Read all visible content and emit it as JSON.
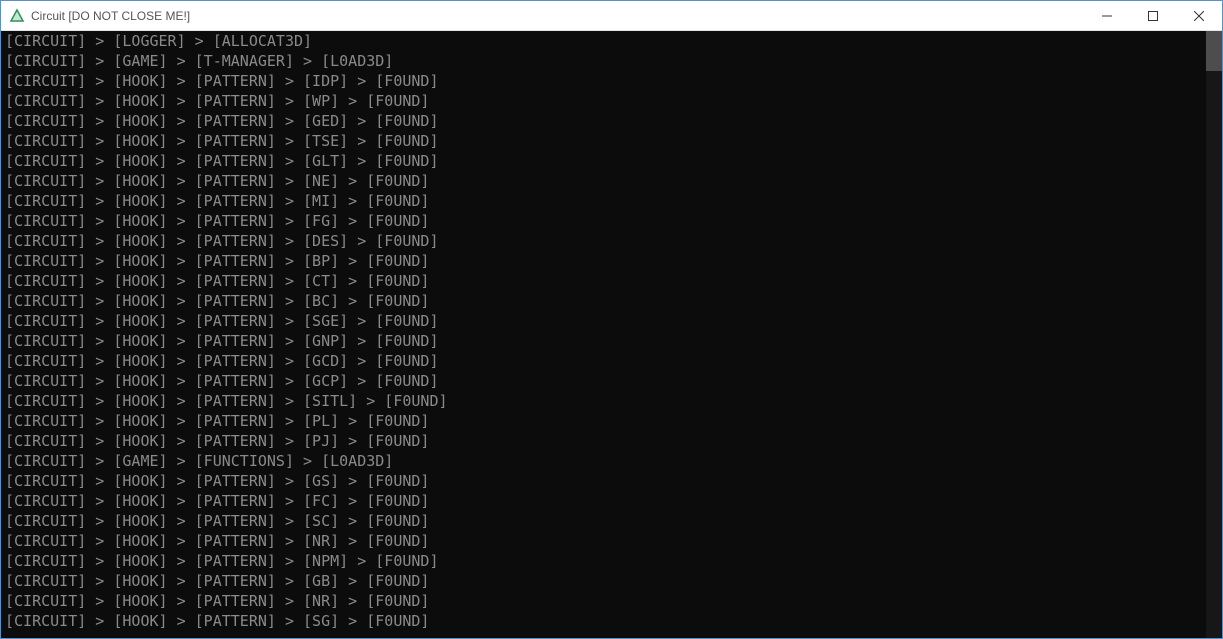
{
  "window": {
    "title": "Circuit [DO NOT CLOSE ME!]"
  },
  "log_lines": [
    [
      [
        "CIRCUIT"
      ],
      [
        "LOGGER"
      ],
      [
        "ALLOCAT3D"
      ]
    ],
    [
      [
        "CIRCUIT"
      ],
      [
        "GAME"
      ],
      [
        "T-MANAGER"
      ],
      [
        "L0AD3D"
      ]
    ],
    [
      [
        "CIRCUIT"
      ],
      [
        "HOOK"
      ],
      [
        "PATTERN"
      ],
      [
        "IDP"
      ],
      [
        "F0UND"
      ]
    ],
    [
      [
        "CIRCUIT"
      ],
      [
        "HOOK"
      ],
      [
        "PATTERN"
      ],
      [
        "WP"
      ],
      [
        "F0UND"
      ]
    ],
    [
      [
        "CIRCUIT"
      ],
      [
        "HOOK"
      ],
      [
        "PATTERN"
      ],
      [
        "GED"
      ],
      [
        "F0UND"
      ]
    ],
    [
      [
        "CIRCUIT"
      ],
      [
        "HOOK"
      ],
      [
        "PATTERN"
      ],
      [
        "TSE"
      ],
      [
        "F0UND"
      ]
    ],
    [
      [
        "CIRCUIT"
      ],
      [
        "HOOK"
      ],
      [
        "PATTERN"
      ],
      [
        "GLT"
      ],
      [
        "F0UND"
      ]
    ],
    [
      [
        "CIRCUIT"
      ],
      [
        "HOOK"
      ],
      [
        "PATTERN"
      ],
      [
        "NE"
      ],
      [
        "F0UND"
      ]
    ],
    [
      [
        "CIRCUIT"
      ],
      [
        "HOOK"
      ],
      [
        "PATTERN"
      ],
      [
        "MI"
      ],
      [
        "F0UND"
      ]
    ],
    [
      [
        "CIRCUIT"
      ],
      [
        "HOOK"
      ],
      [
        "PATTERN"
      ],
      [
        "FG"
      ],
      [
        "F0UND"
      ]
    ],
    [
      [
        "CIRCUIT"
      ],
      [
        "HOOK"
      ],
      [
        "PATTERN"
      ],
      [
        "DES"
      ],
      [
        "F0UND"
      ]
    ],
    [
      [
        "CIRCUIT"
      ],
      [
        "HOOK"
      ],
      [
        "PATTERN"
      ],
      [
        "BP"
      ],
      [
        "F0UND"
      ]
    ],
    [
      [
        "CIRCUIT"
      ],
      [
        "HOOK"
      ],
      [
        "PATTERN"
      ],
      [
        "CT"
      ],
      [
        "F0UND"
      ]
    ],
    [
      [
        "CIRCUIT"
      ],
      [
        "HOOK"
      ],
      [
        "PATTERN"
      ],
      [
        "BC"
      ],
      [
        "F0UND"
      ]
    ],
    [
      [
        "CIRCUIT"
      ],
      [
        "HOOK"
      ],
      [
        "PATTERN"
      ],
      [
        "SGE"
      ],
      [
        "F0UND"
      ]
    ],
    [
      [
        "CIRCUIT"
      ],
      [
        "HOOK"
      ],
      [
        "PATTERN"
      ],
      [
        "GNP"
      ],
      [
        "F0UND"
      ]
    ],
    [
      [
        "CIRCUIT"
      ],
      [
        "HOOK"
      ],
      [
        "PATTERN"
      ],
      [
        "GCD"
      ],
      [
        "F0UND"
      ]
    ],
    [
      [
        "CIRCUIT"
      ],
      [
        "HOOK"
      ],
      [
        "PATTERN"
      ],
      [
        "GCP"
      ],
      [
        "F0UND"
      ]
    ],
    [
      [
        "CIRCUIT"
      ],
      [
        "HOOK"
      ],
      [
        "PATTERN"
      ],
      [
        "SITL"
      ],
      [
        "F0UND"
      ]
    ],
    [
      [
        "CIRCUIT"
      ],
      [
        "HOOK"
      ],
      [
        "PATTERN"
      ],
      [
        "PL"
      ],
      [
        "F0UND"
      ]
    ],
    [
      [
        "CIRCUIT"
      ],
      [
        "HOOK"
      ],
      [
        "PATTERN"
      ],
      [
        "PJ"
      ],
      [
        "F0UND"
      ]
    ],
    [
      [
        "CIRCUIT"
      ],
      [
        "GAME"
      ],
      [
        "FUNCTIONS"
      ],
      [
        "L0AD3D"
      ]
    ],
    [
      [
        "CIRCUIT"
      ],
      [
        "HOOK"
      ],
      [
        "PATTERN"
      ],
      [
        "GS"
      ],
      [
        "F0UND"
      ]
    ],
    [
      [
        "CIRCUIT"
      ],
      [
        "HOOK"
      ],
      [
        "PATTERN"
      ],
      [
        "FC"
      ],
      [
        "F0UND"
      ]
    ],
    [
      [
        "CIRCUIT"
      ],
      [
        "HOOK"
      ],
      [
        "PATTERN"
      ],
      [
        "SC"
      ],
      [
        "F0UND"
      ]
    ],
    [
      [
        "CIRCUIT"
      ],
      [
        "HOOK"
      ],
      [
        "PATTERN"
      ],
      [
        "NR"
      ],
      [
        "F0UND"
      ]
    ],
    [
      [
        "CIRCUIT"
      ],
      [
        "HOOK"
      ],
      [
        "PATTERN"
      ],
      [
        "NPM"
      ],
      [
        "F0UND"
      ]
    ],
    [
      [
        "CIRCUIT"
      ],
      [
        "HOOK"
      ],
      [
        "PATTERN"
      ],
      [
        "GB"
      ],
      [
        "F0UND"
      ]
    ],
    [
      [
        "CIRCUIT"
      ],
      [
        "HOOK"
      ],
      [
        "PATTERN"
      ],
      [
        "NR"
      ],
      [
        "F0UND"
      ]
    ],
    [
      [
        "CIRCUIT"
      ],
      [
        "HOOK"
      ],
      [
        "PATTERN"
      ],
      [
        "SG"
      ],
      [
        "F0UND"
      ]
    ]
  ]
}
